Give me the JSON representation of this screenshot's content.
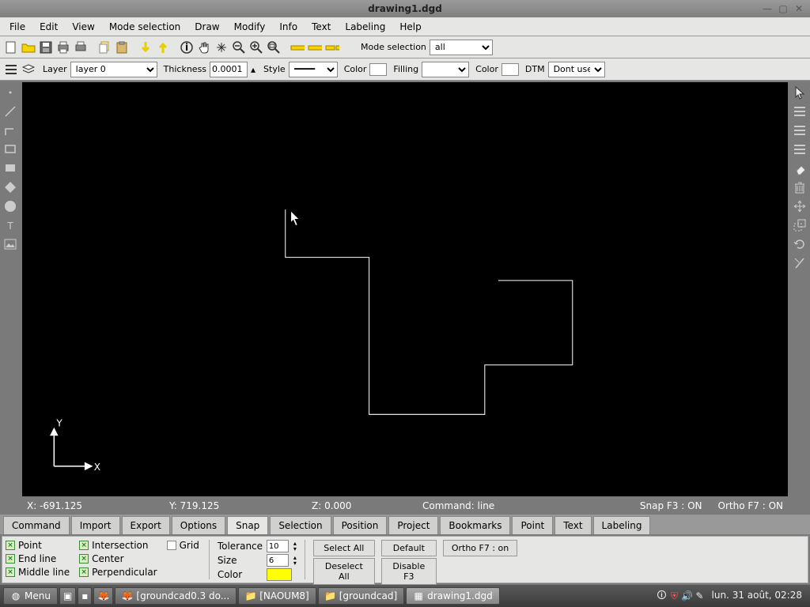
{
  "window": {
    "title": "drawing1.dgd"
  },
  "menu": {
    "items": [
      "File",
      "Edit",
      "View",
      "Mode selection",
      "Draw",
      "Modify",
      "Info",
      "Text",
      "Labeling",
      "Help"
    ]
  },
  "toolbar1": {
    "mode_selection_label": "Mode selection",
    "mode_selection_value": "all"
  },
  "props": {
    "layer_label": "Layer",
    "layer_value": "layer 0",
    "thickness_label": "Thickness",
    "thickness_value": "0.0001",
    "style_label": "Style",
    "color_label": "Color",
    "filling_label": "Filling",
    "color2_label": "Color",
    "dtm_label": "DTM",
    "dtm_value": "Dont use"
  },
  "status": {
    "x": "X: -691.125",
    "y": "Y: 719.125",
    "z": "Z: 0.000",
    "command": "Command: line",
    "snap": "Snap F3 : ON",
    "ortho": "Ortho F7 : ON"
  },
  "axes": {
    "x": "X",
    "y": "Y"
  },
  "tabs": {
    "items": [
      "Command",
      "Import",
      "Export",
      "Options",
      "Snap",
      "Selection",
      "Position",
      "Project",
      "Bookmarks",
      "Point",
      "Text",
      "Labeling"
    ],
    "active_index": 4
  },
  "snap_panel": {
    "col1": [
      "Point",
      "End line",
      "Middle line"
    ],
    "col2": [
      "Intersection",
      "Center",
      "Perpendicular"
    ],
    "grid_label": "Grid",
    "tolerance_label": "Tolerance",
    "tolerance_value": "10",
    "size_label": "Size",
    "size_value": "6",
    "color_label": "Color",
    "buttons": {
      "select_all": "Select All",
      "default": "Default",
      "ortho": "Ortho F7 : on",
      "deselect_all": "Deselect All",
      "disable": "Disable  F3"
    }
  },
  "taskbar": {
    "menu_label": "Menu",
    "items": [
      "[groundcad0.3 do...",
      "[NAOUM8]",
      "[groundcad]",
      "drawing1.dgd"
    ],
    "active_index": 3,
    "clock": "lun. 31 août, 02:28"
  },
  "icons": {
    "new": "□",
    "open": "📁",
    "save": "💾",
    "print": "🖨",
    "copy": "📋",
    "paste": "📄",
    "undo_y": "⬇",
    "redo_y": "⬆",
    "info": "ⓘ",
    "hand": "✋",
    "zoomfit": "⛶",
    "zoomout": "🔍-",
    "zoomin": "🔍+",
    "zoombox": "🔍▭",
    "ruler": "▅",
    "ruler2": "▅",
    "ruler3": "▅▅"
  }
}
